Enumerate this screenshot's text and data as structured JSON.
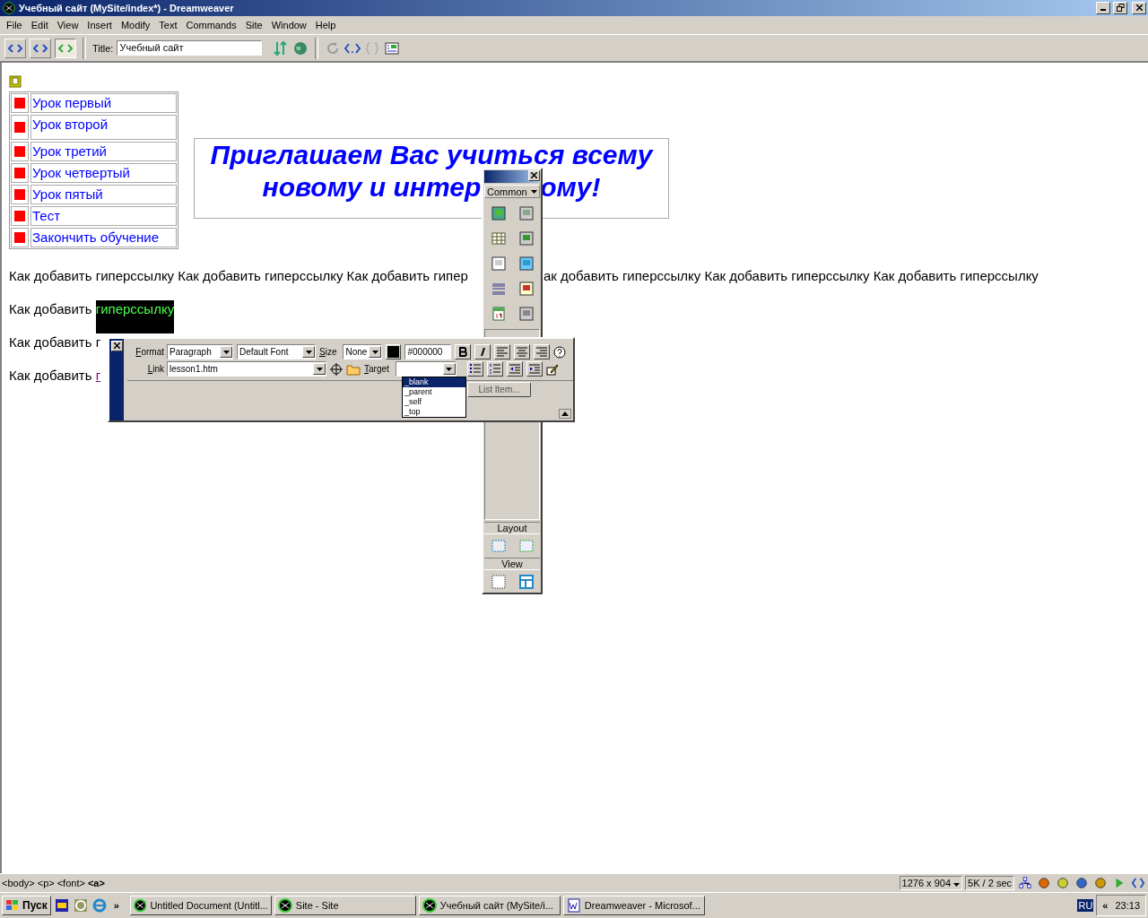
{
  "window": {
    "title": "Учебный сайт (MySite/index*) - Dreamweaver"
  },
  "menu": [
    "File",
    "Edit",
    "View",
    "Insert",
    "Modify",
    "Text",
    "Commands",
    "Site",
    "Window",
    "Help"
  ],
  "toolbar": {
    "view_modes": [
      {
        "selected": false
      },
      {
        "selected": false
      },
      {
        "selected": true
      }
    ],
    "title_label": "Title:",
    "title_value": "Учебный сайт"
  },
  "document": {
    "nav_links": [
      "Урок первый",
      "Урок второй",
      "Урок третий",
      "Урок четвертый",
      "Урок пятый",
      "Тест",
      "Закончить обучение"
    ],
    "heading": [
      {
        "segments": [
          "Приглашаем Вас учиться всему"
        ]
      },
      {
        "segments": [
          "новому и интер",
          "ому!"
        ]
      }
    ],
    "paragraphs": [
      {
        "segments": [
          {
            "text": "Как добавить гиперссылку Как добавить гиперссылку Как добавить гипер",
            "kind": "plain"
          },
          {
            "text": "ак добавить гиперссылку Как добавить гиперссылку Как добавить гиперссылку",
            "kind": "plain"
          }
        ]
      },
      {
        "segments": [
          {
            "text": "Как добавить ",
            "kind": "plain"
          },
          {
            "text": "гиперссылку",
            "kind": "highlight"
          }
        ]
      },
      {
        "segments": [
          {
            "text": "Как добавить г",
            "kind": "plain"
          }
        ]
      },
      {
        "segments": [
          {
            "text": "Как добавить ",
            "kind": "plain"
          },
          {
            "text": "г",
            "kind": "link"
          }
        ]
      }
    ]
  },
  "insert_panel": {
    "category": "Common",
    "sections": [
      "Layout",
      "View"
    ]
  },
  "inspector": {
    "format_label": "Format",
    "format_value": "Paragraph",
    "font_value": "Default Font",
    "size_label": "Size",
    "size_value": "None",
    "color_value": "#000000",
    "link_label": "Link",
    "link_value": "lesson1.htm",
    "target_label": "Target",
    "target_options": [
      {
        "label": "_blank",
        "selected": true
      },
      {
        "label": "_parent",
        "selected": false
      },
      {
        "label": "_self",
        "selected": false
      },
      {
        "label": "_top",
        "selected": false
      }
    ],
    "list_item_button": "List Item..."
  },
  "status_bar": {
    "tags": [
      {
        "label": "<body>",
        "selected": false
      },
      {
        "label": "<p>",
        "selected": false
      },
      {
        "label": "<font>",
        "selected": false
      },
      {
        "label": "<a>",
        "selected": true
      }
    ],
    "window_size": "1276 x 904",
    "download": "5K / 2 sec"
  },
  "taskbar": {
    "start": "Пуск",
    "more": "»",
    "tasks": [
      "Untitled Document (Untitl...",
      "Site - Site",
      "Учебный сайт (MySite/i...",
      "Dreamweaver - Microsof..."
    ],
    "tray_toggle": "«",
    "language": "RU",
    "clock": "23:13"
  }
}
